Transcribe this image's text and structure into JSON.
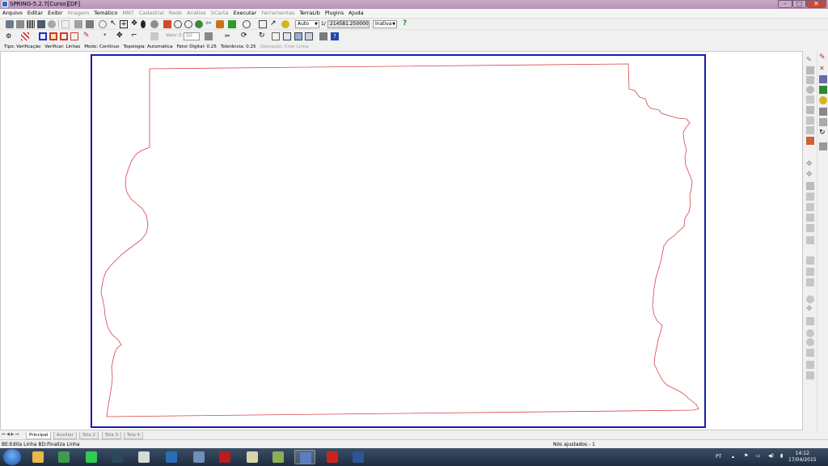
{
  "window": {
    "title": "SPRING-5.2.7[Curso][DF]",
    "minimize_glyph": "–",
    "maximize_glyph": "□",
    "close_glyph": "✕"
  },
  "menu": {
    "items": [
      {
        "label": "Arquivo",
        "enabled": true
      },
      {
        "label": "Editar",
        "enabled": true
      },
      {
        "label": "Exibir",
        "enabled": true
      },
      {
        "label": "Imagem",
        "enabled": false
      },
      {
        "label": "Temático",
        "enabled": true
      },
      {
        "label": "MNT",
        "enabled": false
      },
      {
        "label": "Cadastral",
        "enabled": false
      },
      {
        "label": "Rede",
        "enabled": false
      },
      {
        "label": "Análise",
        "enabled": false
      },
      {
        "label": "SCarta",
        "enabled": false
      },
      {
        "label": "Executar",
        "enabled": true
      },
      {
        "label": "Ferramentas",
        "enabled": false
      },
      {
        "label": "TerraLib",
        "enabled": true
      },
      {
        "label": "Plugins",
        "enabled": true
      },
      {
        "label": "Ajuda",
        "enabled": true
      }
    ]
  },
  "toolbar": {
    "scale_mode": "Auto",
    "scale_prefix": "1/",
    "scale_value": "214581.250000",
    "state_select": "Inativa",
    "valor_z_label": "Valor Z:",
    "valor_z_value": "50"
  },
  "edit_info": {
    "items": [
      {
        "text": "Tipo: Verificação",
        "enabled": true
      },
      {
        "text": "Verificar: Linhas",
        "enabled": true
      },
      {
        "text": "Modo: Contínuo",
        "enabled": true
      },
      {
        "text": "Topologia: Automática",
        "enabled": true
      },
      {
        "text": "Fator Digital: 0.25",
        "enabled": true
      },
      {
        "text": "Tolerância: 0.25",
        "enabled": true
      },
      {
        "text": "Operação: Criar Linha",
        "enabled": false
      }
    ]
  },
  "map": {
    "frame_color": "#1b1bb0",
    "boundary_color": "#d8424c"
  },
  "tabs": {
    "nav": "⏮ ◀ ▶ ⏭",
    "items": [
      {
        "label": "Principal",
        "active": true
      },
      {
        "label": "Auxiliar",
        "active": false
      },
      {
        "label": "Tela 2",
        "active": false
      },
      {
        "label": "Tela 3",
        "active": false
      },
      {
        "label": "Tela 4",
        "active": false
      }
    ]
  },
  "status": {
    "left": "BE:Edita Linha  BD:Finaliza Linha",
    "right": "Nós ajustados - 1"
  },
  "taskbar": {
    "apps": [
      {
        "name": "explorer-icon",
        "color": "#e8b94a",
        "active": false
      },
      {
        "name": "chrome-icon",
        "color": "#3d9c4f",
        "active": false
      },
      {
        "name": "spotify-icon",
        "color": "#2ecc55",
        "active": false
      },
      {
        "name": "steam-icon",
        "color": "#2a475e",
        "active": false
      },
      {
        "name": "skype-icon",
        "color": "#d8d8d8",
        "active": false
      },
      {
        "name": "earth-icon",
        "color": "#2b6db5",
        "active": false
      },
      {
        "name": "r-icon",
        "color": "#6f8fbd",
        "active": false
      },
      {
        "name": "mendeley-icon",
        "color": "#b91c1c",
        "active": false
      },
      {
        "name": "zotero-icon",
        "color": "#d9d3a8",
        "active": false
      },
      {
        "name": "qgis-icon",
        "color": "#8fae55",
        "active": false
      },
      {
        "name": "spring-icon",
        "color": "#5a7fc0",
        "active": true
      },
      {
        "name": "acrobat-icon",
        "color": "#c8251a",
        "active": false
      },
      {
        "name": "word-icon",
        "color": "#2b579a",
        "active": false
      }
    ],
    "tray": {
      "language": "PT",
      "time": "14:12",
      "date": "17/04/2015"
    }
  }
}
